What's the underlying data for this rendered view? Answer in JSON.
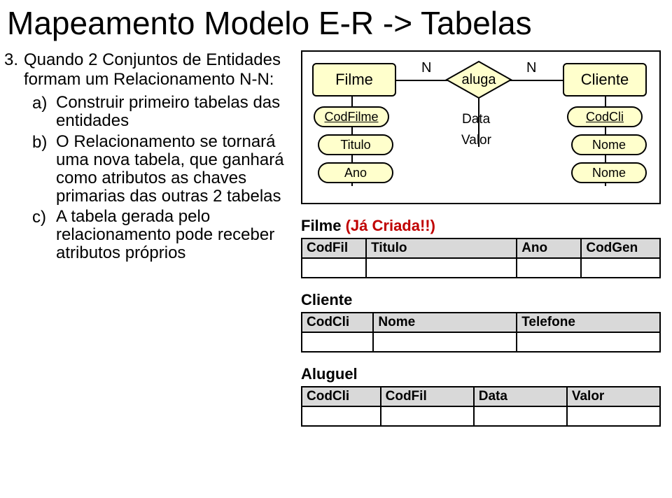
{
  "title": "Mapeamento Modelo E-R -> Tabelas",
  "step": {
    "number": "3.",
    "text": "Quando 2 Conjuntos de Entidades formam um Relacionamento N-N:"
  },
  "substeps": {
    "a": {
      "letter": "a)",
      "text": "Construir primeiro tabelas das entidades"
    },
    "b": {
      "letter": "b)",
      "text": "O Relacionamento se tornará uma nova tabela, que ganhará como atributos as chaves primarias das outras 2 tabelas"
    },
    "c": {
      "letter": "c)",
      "text": "A tabela gerada pelo relacionamento pode receber atributos próprios"
    }
  },
  "er": {
    "entity_filme": "Filme",
    "entity_cliente": "Cliente",
    "rel_aluga": "aluga",
    "card_left": "N",
    "card_right": "N",
    "filme_attrs": {
      "codfilme": "CodFilme",
      "titulo": "Titulo",
      "ano": "Ano"
    },
    "cliente_attrs": {
      "codcli": "CodCli",
      "nome1": "Nome",
      "nome2": "Nome"
    },
    "rel_attrs": {
      "data": "Data",
      "valor": "Valor"
    }
  },
  "tables": {
    "filme": {
      "title_prefix": "Filme",
      "title_suffix": "(Já Criada!!)",
      "headers": [
        "CodFil",
        "Titulo",
        "Ano",
        "CodGen"
      ]
    },
    "cliente": {
      "title": "Cliente",
      "headers": [
        "CodCli",
        "Nome",
        "Telefone"
      ]
    },
    "aluguel": {
      "title": "Aluguel",
      "headers": [
        "CodCli",
        "CodFil",
        "Data",
        "Valor"
      ]
    }
  },
  "chart_data": {
    "type": "diagram",
    "kind": "entity-relationship",
    "entities": [
      {
        "name": "Filme",
        "attributes": [
          "CodFilme",
          "Titulo",
          "Ano"
        ],
        "key": "CodFilme"
      },
      {
        "name": "Cliente",
        "attributes": [
          "CodCli",
          "Nome",
          "Nome"
        ],
        "key": "CodCli"
      }
    ],
    "relationships": [
      {
        "name": "aluga",
        "between": [
          "Filme",
          "Cliente"
        ],
        "cardinality": [
          "N",
          "N"
        ],
        "attributes": [
          "Data",
          "Valor"
        ]
      }
    ],
    "mapped_tables": [
      {
        "name": "Filme",
        "note": "(Já Criada!!)",
        "columns": [
          "CodFil",
          "Titulo",
          "Ano",
          "CodGen"
        ]
      },
      {
        "name": "Cliente",
        "columns": [
          "CodCli",
          "Nome",
          "Telefone"
        ]
      },
      {
        "name": "Aluguel",
        "columns": [
          "CodCli",
          "CodFil",
          "Data",
          "Valor"
        ]
      }
    ]
  }
}
